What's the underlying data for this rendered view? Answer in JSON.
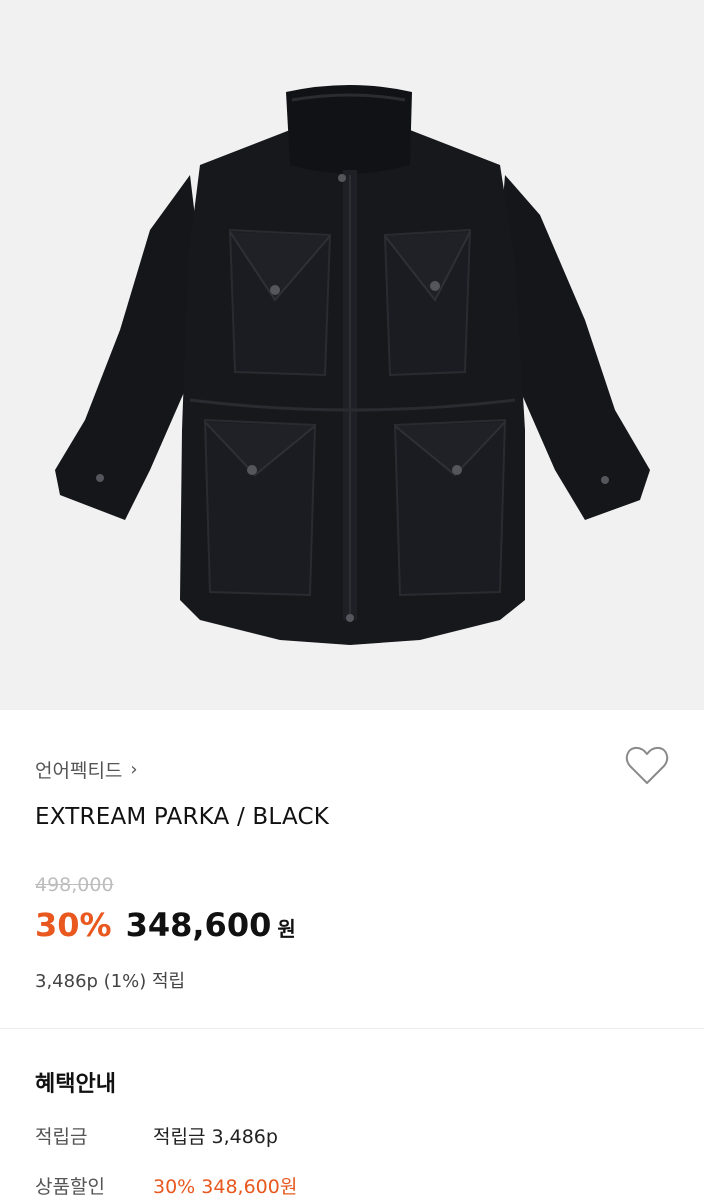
{
  "product": {
    "brand": "언어펙티드",
    "brand_chevron": "›",
    "name": "EXTREAM PARKA / BLACK",
    "original_price": "498,000",
    "discount": "30%",
    "price": "348,600",
    "currency": "원",
    "points_text": "3,486p (1%) 적립",
    "image_alt": "jacket-photo"
  },
  "benefits": {
    "title": "혜택안내",
    "rows": [
      {
        "label": "적립금",
        "value": "적립금 3,486p"
      },
      {
        "label": "상품할인",
        "value": "30% 348,600원"
      }
    ]
  },
  "colors": {
    "accent": "#e8581f",
    "photo_bg": "#f1f1f1",
    "jacket": "#16171b"
  },
  "icons": {
    "wishlist": "heart-outline-icon",
    "brand_link": "chevron-right-icon"
  }
}
